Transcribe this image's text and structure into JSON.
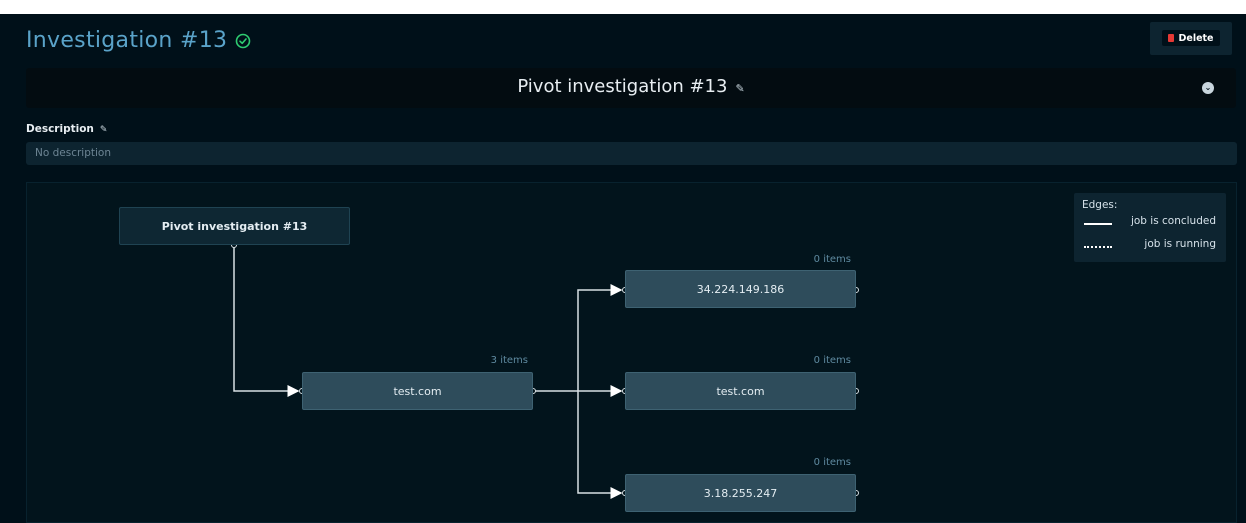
{
  "header": {
    "title": "Investigation #13",
    "status_icon": "check-circle-icon",
    "delete_label": "Delete"
  },
  "name_bar": {
    "name": "Pivot investigation #13"
  },
  "description": {
    "label": "Description",
    "value": "No description"
  },
  "graph": {
    "root": {
      "label": "Pivot investigation #13"
    },
    "nodes": [
      {
        "label": "test.com",
        "count": "3 items"
      },
      {
        "label": "34.224.149.186",
        "count": "0 items"
      },
      {
        "label": "test.com",
        "count": "0 items"
      },
      {
        "label": "3.18.255.247",
        "count": "0 items"
      }
    ]
  },
  "legend": {
    "title": "Edges:",
    "solid_label": "job is concluded",
    "dashed_label": "job is running"
  },
  "colors": {
    "background": "#001019",
    "accent": "#5aa3c9",
    "success": "#2ecc71",
    "danger": "#e53935"
  }
}
